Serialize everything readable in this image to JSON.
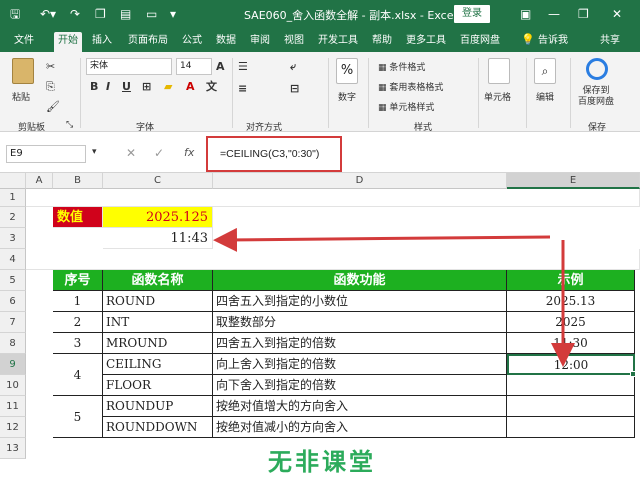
{
  "title_bar": {
    "title": "SAE060_舍入函数全解 - 副本.xlsx - Excel",
    "login": "登录",
    "minimize": "—",
    "restore": "❐",
    "close": "✕"
  },
  "tabs": [
    "文件",
    "开始",
    "插入",
    "页面布局",
    "公式",
    "数据",
    "审阅",
    "视图",
    "开发工具",
    "帮助",
    "更多工具",
    "百度网盘",
    "告诉我",
    "共享"
  ],
  "ribbon": {
    "paste": "粘贴",
    "clipboard": "剪贴板",
    "font_name": "宋体",
    "font_size": "14",
    "font_group": "字体",
    "align_group": "对齐方式",
    "number": "数字",
    "cond_format": "条件格式",
    "table_format": "套用表格格式",
    "cell_style": "单元格样式",
    "style_group": "样式",
    "cells": "单元格",
    "edit": "编辑",
    "save_baidu": "保存到\n百度网盘",
    "save": "保存"
  },
  "formula_bar": {
    "name_box": "E9",
    "formula": "=CEILING(C3,\"0:30\")"
  },
  "columns": [
    "A",
    "B",
    "C",
    "D",
    "E"
  ],
  "rows": [
    "1",
    "2",
    "3",
    "4",
    "5",
    "6",
    "7",
    "8",
    "9",
    "10",
    "11",
    "12",
    "13"
  ],
  "sheet": {
    "label_value": "数值",
    "value": "2025.125",
    "time": "11:43",
    "headers": [
      "序号",
      "函数名称",
      "函数功能",
      "示例"
    ],
    "table": [
      {
        "no": "1",
        "name": "ROUND",
        "desc": "四舍五入到指定的小数位",
        "example": "2025.13"
      },
      {
        "no": "2",
        "name": "INT",
        "desc": "取整数部分",
        "example": "2025"
      },
      {
        "no": "3",
        "name": "MROUND",
        "desc": "四舍五入到指定的倍数",
        "example": "11:30"
      },
      {
        "no": "4",
        "name": "CEILING",
        "desc": "向上舍入到指定的倍数",
        "example": "12:00"
      },
      {
        "no": "",
        "name": "FLOOR",
        "desc": "向下舍入到指定的倍数",
        "example": ""
      },
      {
        "no": "5",
        "name": "ROUNDUP",
        "desc": "按绝对值增大的方向舍入",
        "example": ""
      },
      {
        "no": "",
        "name": "ROUNDDOWN",
        "desc": "按绝对值减小的方向舍入",
        "example": ""
      }
    ]
  },
  "watermark": "无非课堂",
  "colors": {
    "excel_green": "#217346",
    "header_green": "#1db020",
    "value_red": "#d0021b",
    "value_yellow": "#ffff00",
    "arrow_red": "#d33b3b"
  }
}
